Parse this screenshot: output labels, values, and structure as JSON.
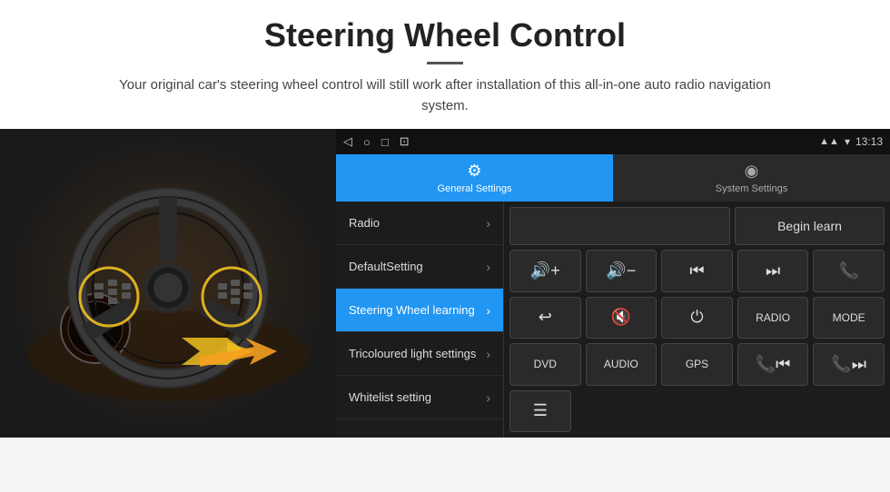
{
  "header": {
    "title": "Steering Wheel Control",
    "subtitle": "Your original car's steering wheel control will still work after installation of this all-in-one auto radio navigation system."
  },
  "status_bar": {
    "nav_back": "◁",
    "nav_home": "○",
    "nav_recent": "□",
    "nav_extra": "⊡",
    "signal": "▾▴",
    "wifi": "▾",
    "time": "13:13"
  },
  "tabs": [
    {
      "id": "general",
      "label": "General Settings",
      "icon": "⚙",
      "active": true
    },
    {
      "id": "system",
      "label": "System Settings",
      "icon": "◉",
      "active": false
    }
  ],
  "menu": {
    "items": [
      {
        "label": "Radio",
        "active": false
      },
      {
        "label": "DefaultSetting",
        "active": false
      },
      {
        "label": "Steering Wheel learning",
        "active": true
      },
      {
        "label": "Tricoloured light settings",
        "active": false
      },
      {
        "label": "Whitelist setting",
        "active": false
      }
    ]
  },
  "right_panel": {
    "begin_learn_label": "Begin learn",
    "buttons_row1": [
      "🔊+",
      "🔊−",
      "⏮",
      "⏭",
      "📞"
    ],
    "buttons_row2": [
      "↩",
      "🔊✕",
      "⏻",
      "RADIO",
      "MODE"
    ],
    "buttons_row3": [
      "DVD",
      "AUDIO",
      "GPS",
      "📞⏮",
      "📞⏭"
    ],
    "buttons_row4_icon": "≡"
  }
}
